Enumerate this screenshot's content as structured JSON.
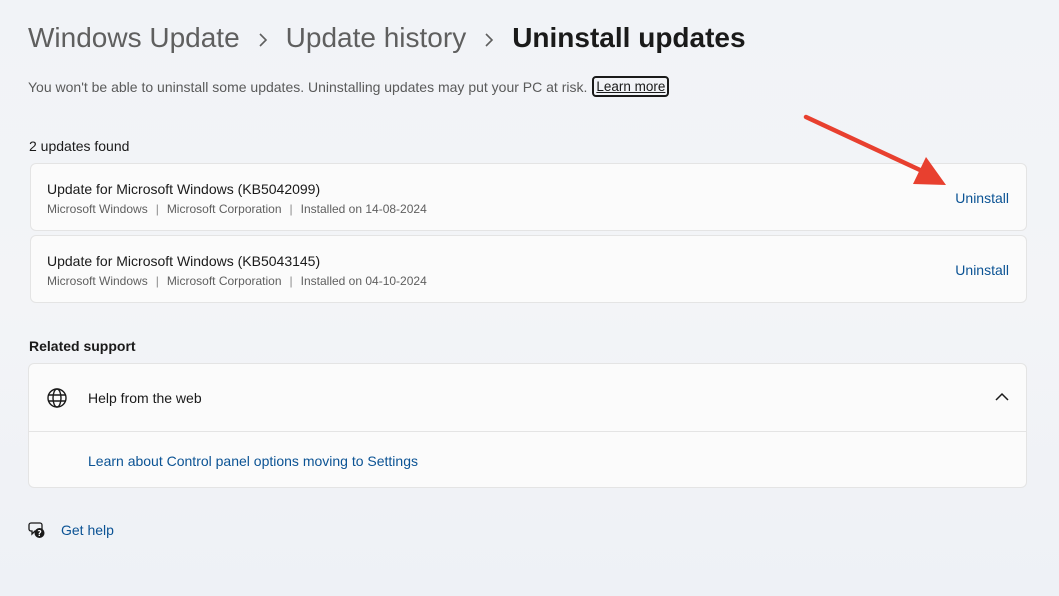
{
  "breadcrumb": {
    "items": [
      "Windows Update",
      "Update history",
      "Uninstall updates"
    ]
  },
  "warning": {
    "text": "You won't be able to uninstall some updates. Uninstalling updates may put your PC at risk.",
    "learn_more": "Learn more"
  },
  "updates": {
    "count_label": "2 updates found",
    "items": [
      {
        "title": "Update for Microsoft Windows (KB5042099)",
        "product": "Microsoft Windows",
        "publisher": "Microsoft Corporation",
        "installed": "Installed on 14-08-2024",
        "action": "Uninstall"
      },
      {
        "title": "Update for Microsoft Windows (KB5043145)",
        "product": "Microsoft Windows",
        "publisher": "Microsoft Corporation",
        "installed": "Installed on 04-10-2024",
        "action": "Uninstall"
      }
    ]
  },
  "related_support": {
    "label": "Related support",
    "expander_title": "Help from the web",
    "expanded": true,
    "link": "Learn about Control panel options moving to Settings"
  },
  "get_help": {
    "label": "Get help"
  },
  "icons": {
    "breadcrumb_separator": "chevron-right-icon",
    "support": "globe-icon",
    "expander": "chevron-up-icon",
    "help": "help-chat-icon"
  },
  "colors": {
    "link": "#0b5394",
    "annotation_arrow": "#e8402f",
    "card_background": "#fbfbfb"
  }
}
